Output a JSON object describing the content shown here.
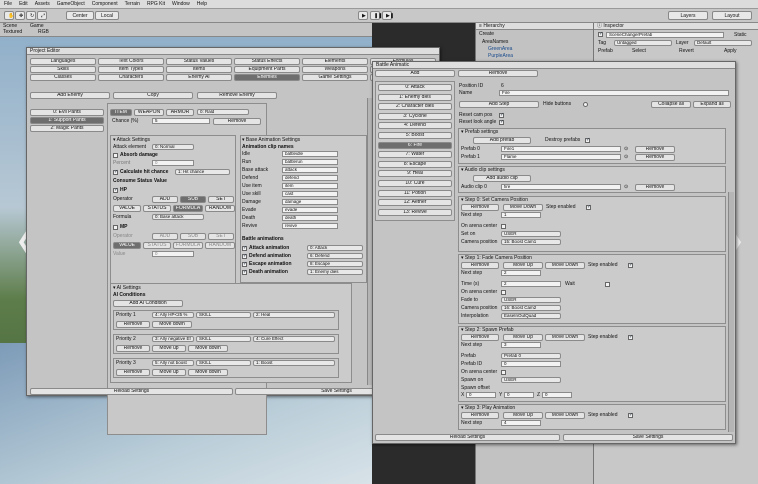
{
  "menu": [
    "File",
    "Edit",
    "Assets",
    "GameObject",
    "Component",
    "Terrain",
    "RPG Kit",
    "Window",
    "Help"
  ],
  "toolbar": {
    "center": "Center",
    "local": "Local",
    "layers": "Layers",
    "layout": "Layout"
  },
  "scene": {
    "tab": "Scene",
    "game_tab": "Game",
    "textured": "Textured",
    "rgb": "RGB"
  },
  "hierarchy": {
    "tab": "Hierarchy",
    "create": "Create",
    "items": [
      "AreaNames",
      "GreenArea",
      "PurpleArea"
    ]
  },
  "inspector": {
    "tab": "Inspector",
    "object_name": "SceneChangerPrefab",
    "static": "Static",
    "tag_label": "Tag",
    "tag_value": "Untagged",
    "layer_label": "Layer",
    "layer_value": "Default",
    "prefab_label": "Prefab",
    "select": "Select",
    "revert": "Revert",
    "apply": "Apply"
  },
  "project_editor": {
    "title": "Project Editor",
    "tabs_row1": [
      "Languages",
      "Text Colors",
      "Status Values",
      "Status Effects",
      "Elements",
      "Formulas"
    ],
    "tabs_row2": [
      "Skills",
      "Item Types",
      "Items",
      "Equipment Parts",
      "Weapons",
      "Armors"
    ],
    "tabs_row3": [
      "Classes",
      "Characters",
      "Enemy AI",
      "Enemies",
      "Game Settings",
      "Load Save HUD"
    ],
    "add_enemy": "Add Enemy",
    "copy": "Copy",
    "remove_enemy": "Remove Enemy",
    "list": [
      "0: Evil Pants",
      "1: Support Pants",
      "2: Magic Pants"
    ],
    "item_tabs": [
      "ITEM",
      "WEAPON",
      "ARMOR"
    ],
    "item_dd": "0: Rald",
    "chance_label": "Chance (%)",
    "chance_value": "5",
    "remove": "Remove",
    "attack_settings": "Attack Settings",
    "attack_element": "Attack element",
    "attack_element_value": "0: Normal",
    "absorb_damage": "Absorb damage",
    "percent": "Percent",
    "percent_value": "0",
    "calc_hit": "Calculate hit chance",
    "calc_hit_dd": "1: Hit chance",
    "consume": "Consume Status Value",
    "hp": "HP",
    "operator": "Operator",
    "op_btns": [
      "ADD",
      "SUB",
      "SET"
    ],
    "val_btns": [
      "VALUE",
      "STATUS",
      "FORMULA",
      "RANDOM"
    ],
    "formula": "Formula",
    "formula_dd": "0: Base attack",
    "mp": "MP",
    "value_label": "Value",
    "value_val": "0",
    "ai_settings": "AI Settings",
    "ai_conditions": "AI Conditions",
    "add_ai": "Add AI Condition",
    "priority_rows": [
      {
        "label": "Priority 1",
        "cond": "4: Ally HP<25 %",
        "type": "SKILL",
        "action": "2: Heal"
      },
      {
        "label": "Priority 2",
        "cond": "3: Ally negative Ef",
        "type": "SKILL",
        "action": "4: Cure Effect"
      },
      {
        "label": "Priority 3",
        "cond": "5: Ally not boost",
        "type": "SKILL",
        "action": "1: Boost"
      }
    ],
    "move_up": "Move up",
    "move_down": "Move down",
    "base_anim": "Base Animation Settings",
    "anim_names": "Animation clip names",
    "anim_rows": [
      [
        "Idle",
        "battleidle"
      ],
      [
        "Run",
        "battlerun"
      ],
      [
        "Base attack",
        "attack"
      ],
      [
        "Defend",
        "defend"
      ],
      [
        "Use item",
        "item"
      ],
      [
        "Use skill",
        "cast"
      ],
      [
        "Damage",
        "damage"
      ],
      [
        "Evade",
        "evade"
      ],
      [
        "Death",
        "death"
      ],
      [
        "Revive",
        "revive"
      ]
    ],
    "battle_anims": "Battle animations",
    "battle_rows": [
      [
        "Attack animation",
        "0: Attack"
      ],
      [
        "Defend animation",
        "6: Defend"
      ],
      [
        "Escape animation",
        "8: Escape"
      ],
      [
        "Death animation",
        "1: Enemy dies"
      ]
    ],
    "reload": "Reload Settings",
    "save": "Save Settings"
  },
  "battle_animation": {
    "title": "Battle Animatic",
    "add": "Add",
    "remove": "Remove",
    "list": [
      "0: Attack",
      "1: Enemy dies",
      "2: Character dies",
      "3: Cyclone",
      "4: Defend",
      "5: Boost",
      "6: Fire",
      "7: Water",
      "8: Escape",
      "9: Heal",
      "10: Cure",
      "11: Potion",
      "12: Aether",
      "13: Revive"
    ],
    "selected": 6,
    "position_id_label": "Position ID",
    "position_id": "6",
    "name_label": "Name",
    "name_value": "Fire",
    "add_step": "Add Step",
    "hide_buttons": "Hide buttons",
    "collapse_all": "Collapse all",
    "expand_all": "Expand all",
    "reset_cam": "Reset cam pos",
    "reset_look": "Reset look angle",
    "prefab_settings": "Prefab settings",
    "add_prefab": "Add prefab",
    "destroy_prefabs": "Destroy prefabs",
    "prefab_rows": [
      [
        "Prefab 0",
        "Fire1"
      ],
      [
        "Prefab 1",
        "Flame"
      ]
    ],
    "audio_settings": "Audio clip settings",
    "add_audio": "Add audio clip",
    "audio_row": [
      "Audio clip 0",
      "fire"
    ],
    "step0": {
      "title": "Step 0: Set Camera Position",
      "next": "1",
      "on_arena": "On arena center",
      "set_on": "Set on",
      "set_on_v": "USER",
      "cam_pos": "Camera position",
      "cam_pos_v": "15: Boost Cam1"
    },
    "step1": {
      "title": "Step 1: Fade Camera Position",
      "next": "2",
      "time": "2",
      "wait": "Wait",
      "on_arena": "On arena center",
      "fade_to": "Fade to",
      "fade_to_v": "USER",
      "cam_pos": "Camera position",
      "cam_pos_v": "16: Boost Cam2",
      "interp": "Interpolation",
      "interp_v": "EaseInOutQuad"
    },
    "step2": {
      "title": "Step 2: Spawn Prefab",
      "next": "3",
      "prefab": "Prefab",
      "prefab_v": "Prefab 0",
      "prefab_id": "Prefab ID",
      "prefab_id_v": "0",
      "on_arena": "On arena center",
      "spawn_on": "Spawn on",
      "spawn_on_v": "USER",
      "offset": "Spawn offset",
      "x": "0",
      "y": "0",
      "z": "0"
    },
    "step3": {
      "title": "Step 3: Play Animation",
      "next": "4"
    },
    "move_down": "Move Down",
    "move_up": "Move Up",
    "step_enabled": "Step enabled",
    "next_step": "Next step",
    "time_label": "Time (s)",
    "reload": "Reload Settings",
    "save": "Save Settings"
  }
}
